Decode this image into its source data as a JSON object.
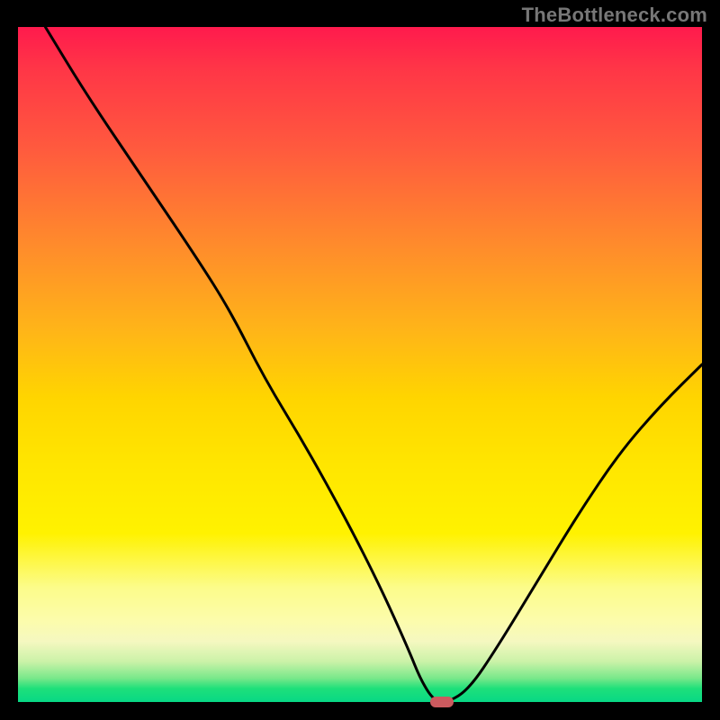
{
  "watermark": {
    "text": "TheBottleneck.com"
  },
  "chart_data": {
    "type": "line",
    "title": "",
    "xlabel": "",
    "ylabel": "",
    "xlim": [
      0,
      100
    ],
    "ylim": [
      0,
      100
    ],
    "grid": false,
    "legend": null,
    "series": [
      {
        "name": "bottleneck-curve",
        "x": [
          4,
          10,
          18,
          26,
          31,
          36,
          42,
          48,
          53,
          57,
          59,
          61,
          63,
          66,
          70,
          76,
          82,
          88,
          94,
          100
        ],
        "y": [
          100,
          90,
          78,
          66,
          58,
          48,
          38,
          27,
          17,
          8,
          3,
          0,
          0,
          2,
          8,
          18,
          28,
          37,
          44,
          50
        ]
      }
    ],
    "marker": {
      "x": 62,
      "y": 0,
      "width_pct": 3.5,
      "height_pct": 1.6,
      "color": "#cc5a5f"
    },
    "background_gradient": {
      "top": "#ff1a4d",
      "mid": "#ffe600",
      "bottom": "#08d885"
    }
  }
}
